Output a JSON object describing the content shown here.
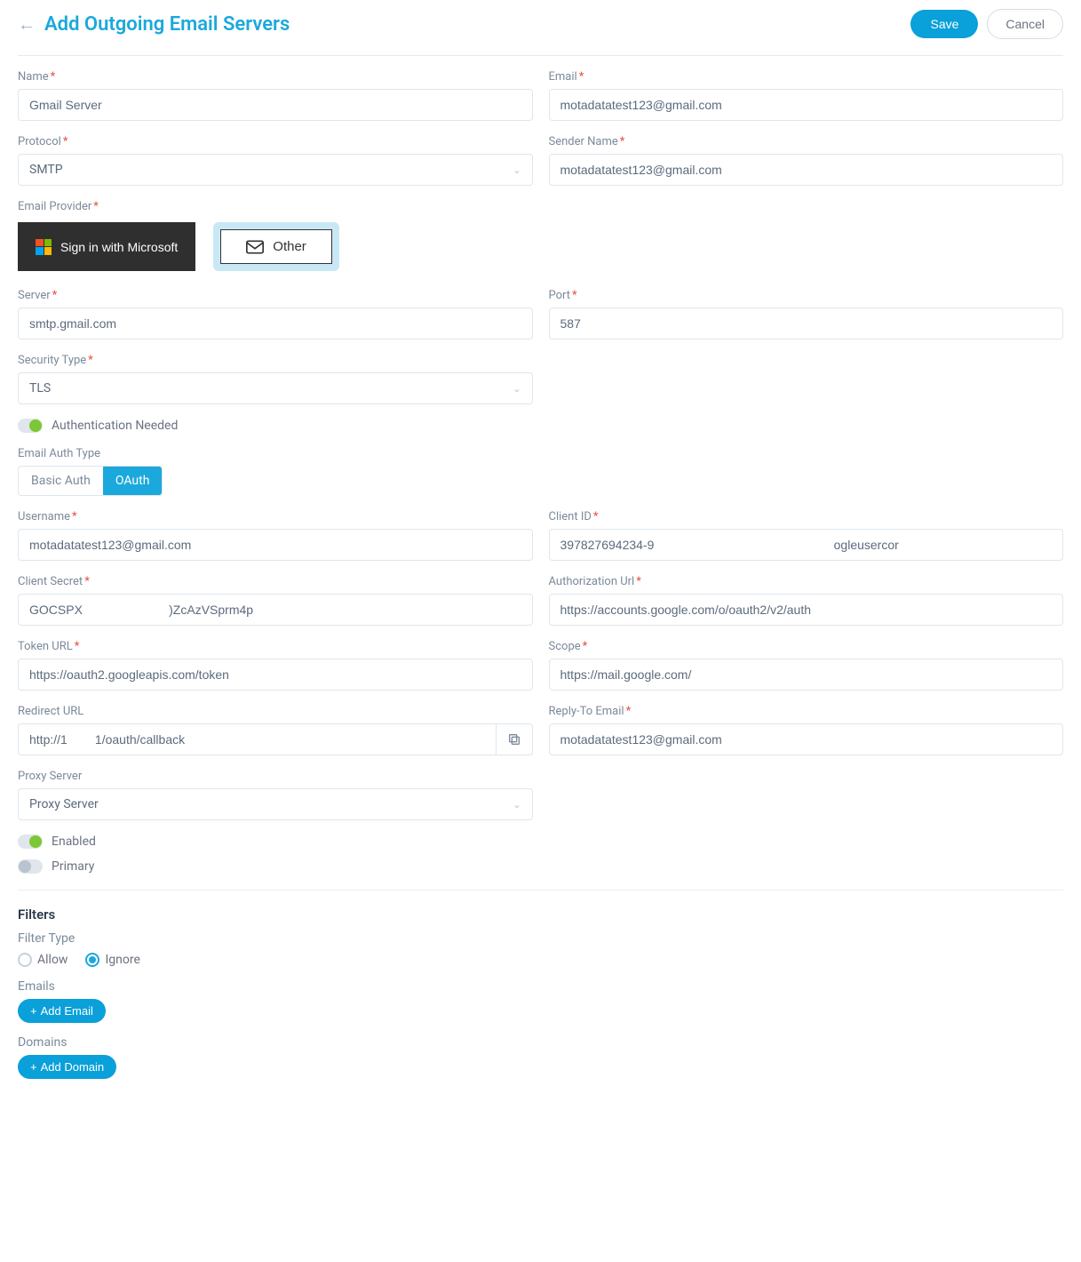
{
  "header": {
    "title": "Add Outgoing Email Servers",
    "save": "Save",
    "cancel": "Cancel"
  },
  "fields": {
    "name": {
      "label": "Name",
      "value": "Gmail Server"
    },
    "email": {
      "label": "Email",
      "value": "motadatatest123@gmail.com"
    },
    "protocol": {
      "label": "Protocol",
      "value": "SMTP"
    },
    "senderName": {
      "label": "Sender Name",
      "value": "motadatatest123@gmail.com"
    },
    "emailProvider": {
      "label": "Email Provider",
      "microsoft": "Sign in with Microsoft",
      "other": "Other"
    },
    "server": {
      "label": "Server",
      "value": "smtp.gmail.com"
    },
    "port": {
      "label": "Port",
      "value": "587"
    },
    "securityType": {
      "label": "Security Type",
      "value": "TLS"
    },
    "authNeeded": {
      "label": "Authentication Needed"
    },
    "emailAuthType": {
      "label": "Email Auth Type",
      "basic": "Basic Auth",
      "oauth": "OAuth"
    },
    "username": {
      "label": "Username",
      "value": "motadatatest123@gmail.com"
    },
    "clientId": {
      "label": "Client ID",
      "value": "397827694234-9                                                    ogleusercor"
    },
    "clientSecret": {
      "label": "Client Secret",
      "value": "GOCSPX                         )ZcAzVSprm4p"
    },
    "authUrl": {
      "label": "Authorization Url",
      "value": "https://accounts.google.com/o/oauth2/v2/auth"
    },
    "tokenUrl": {
      "label": "Token URL",
      "value": "https://oauth2.googleapis.com/token"
    },
    "scope": {
      "label": "Scope",
      "value": "https://mail.google.com/"
    },
    "redirectUrl": {
      "label": "Redirect URL",
      "value": "http://1        1/oauth/callback"
    },
    "replyTo": {
      "label": "Reply-To Email",
      "value": "motadatatest123@gmail.com"
    },
    "proxyServer": {
      "label": "Proxy Server",
      "value": "Proxy Server"
    },
    "enabled": {
      "label": "Enabled"
    },
    "primary": {
      "label": "Primary"
    }
  },
  "filters": {
    "title": "Filters",
    "filterType": {
      "label": "Filter Type",
      "allow": "Allow",
      "ignore": "Ignore"
    },
    "emails": {
      "label": "Emails",
      "addBtn": "Add Email"
    },
    "domains": {
      "label": "Domains",
      "addBtn": "Add Domain"
    }
  }
}
